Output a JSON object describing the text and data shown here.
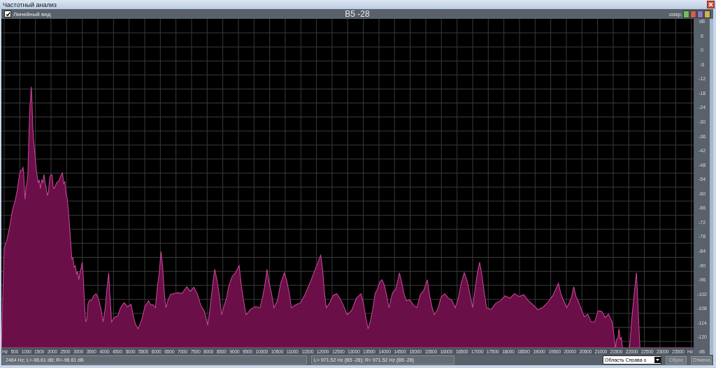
{
  "window": {
    "title": "Частотный анализ"
  },
  "toolbar": {
    "linear_view": {
      "label": "Линейный вид",
      "checked": true
    },
    "title": "B5 -28",
    "save_label": "сохр."
  },
  "y_axis": [
    "dB",
    "6",
    "0",
    "-6",
    "-12",
    "-18",
    "-24",
    "-30",
    "-36",
    "-42",
    "-48",
    "-54",
    "-60",
    "-66",
    "-72",
    "-78",
    "-84",
    "-90",
    "-96",
    "-102",
    "-108",
    "-114",
    "-120",
    "dB"
  ],
  "x_axis": [
    "Hz",
    "500",
    "1000",
    "1500",
    "2000",
    "2500",
    "3000",
    "3500",
    "4000",
    "4500",
    "5000",
    "5500",
    "6000",
    "6500",
    "7000",
    "7500",
    "8000",
    "8500",
    "9000",
    "9500",
    "10000",
    "10500",
    "11000",
    "11500",
    "12000",
    "12500",
    "13000",
    "13500",
    "14000",
    "14500",
    "15000",
    "15500",
    "16000",
    "16500",
    "17000",
    "17500",
    "18000",
    "18500",
    "19000",
    "19500",
    "20000",
    "20500",
    "21000",
    "21500",
    "22000",
    "22500",
    "23000",
    "23500",
    "Hz"
  ],
  "status": {
    "cursor": "2464 Hz; L=-96.61 dB; R=-96.61 dB",
    "peak": "L= 971.52 Hz (B5 -28); R= 971.52 Hz (B5 -28)",
    "area": "Область Справа о"
  },
  "buttons": [
    "Сброс",
    "Отмена"
  ]
}
